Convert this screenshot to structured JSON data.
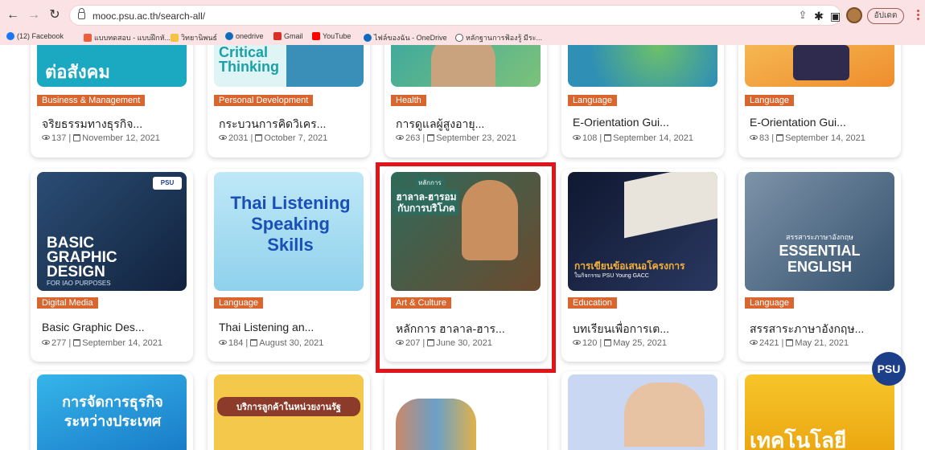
{
  "browser": {
    "url": "mooc.psu.ac.th/search-all/",
    "profile_label": "อัปเดต",
    "bookmarks": [
      {
        "label": "(12) Facebook",
        "color": "#1877f2"
      },
      {
        "label": "แบบทดสอบ - แบบฝึกหั...",
        "color": "#e8613c"
      },
      {
        "label": "วิทยานิพนธ์",
        "color": "#f5c242"
      },
      {
        "label": "onedrive",
        "color": "#0f6cbd"
      },
      {
        "label": "Gmail",
        "color": "#d93025"
      },
      {
        "label": "YouTube",
        "color": "#ff0000"
      },
      {
        "label": "ไฟล์ของฉัน - OneDrive",
        "color": "#0f6cbd"
      },
      {
        "label": "หลักฐานการฟ้องรู้ มีระ...",
        "color": "#555555"
      }
    ]
  },
  "cards_row1": [
    {
      "category": "Business & Management",
      "title": "จริยธรรมทางธุรกิจ...",
      "views": "137",
      "date": "November 12, 2021",
      "thumb_text": "ต่อสังคม",
      "thumb_color": "#1aa9c1"
    },
    {
      "category": "Personal Development",
      "title": "กระบวนการคิดวิเคร...",
      "views": "2031",
      "date": "October 7, 2021",
      "thumb_text": "Critical Thinking",
      "thumb_color": "#dff4f4"
    },
    {
      "category": "Health",
      "title": "การดูแลผู้สูงอายุ...",
      "views": "263",
      "date": "September 23, 2021",
      "thumb_text": "",
      "thumb_color": "#3aa7a0"
    },
    {
      "category": "Language",
      "title": "E-Orientation Gui...",
      "views": "108",
      "date": "September 14, 2021",
      "thumb_text": "",
      "thumb_color": "#2f8fb5"
    },
    {
      "category": "Language",
      "title": "E-Orientation Gui...",
      "views": "83",
      "date": "September 14, 2021",
      "thumb_text": "",
      "thumb_color": "#f2a93b"
    }
  ],
  "cards_row2": [
    {
      "category": "Digital Media",
      "title": "Basic Graphic Des...",
      "views": "277",
      "date": "September 14, 2021",
      "thumb_text": "BASIC GRAPHIC DESIGN",
      "thumb_sub": "FOR IAO PURPOSES",
      "thumb_color": "#1b3355"
    },
    {
      "category": "Language",
      "title": "Thai Listening an...",
      "views": "184",
      "date": "August 30, 2021",
      "thumb_text": "Thai Listening Speaking Skills",
      "thumb_color": "#9fd8ef"
    },
    {
      "category": "Art & Culture",
      "title": "หลักการ ฮาลาล-ฮาร...",
      "views": "207",
      "date": "June 30, 2021",
      "thumb_text": "ฮาลาล-ฮารอม กับการบริโภค",
      "thumb_sub": "หลักการ",
      "thumb_color": "#5a3b26"
    },
    {
      "category": "Education",
      "title": "บทเรียนเพื่อการเต...",
      "views": "120",
      "date": "May 25, 2021",
      "thumb_text": "การเขียนข้อเสนอโครงการ",
      "thumb_sub": "ในกิจกรรม PSU Young GACC",
      "thumb_color": "#141b33"
    },
    {
      "category": "Language",
      "title": "สรรสาระภาษาอังกฤษ...",
      "views": "2421",
      "date": "May 21, 2021",
      "thumb_text": "ESSENTIAL ENGLISH",
      "thumb_sub": "สรรสาระภาษาอังกฤษ",
      "thumb_color": "#4d6a86"
    }
  ],
  "cards_row3": [
    {
      "thumb_text": "การจัดการธุรกิจ ระหว่างประเทศ",
      "thumb_color": "#2aa0e0"
    },
    {
      "thumb_text": "บริการลูกค้าในหน่วยงานรัฐ",
      "thumb_color": "#f3c84b"
    },
    {
      "thumb_text": "",
      "thumb_color": "#ffffff"
    },
    {
      "thumb_text": "",
      "thumb_color": "#c9d7f2"
    },
    {
      "thumb_text": "เทคโนโลยี",
      "thumb_color": "#f3b617"
    }
  ],
  "floating_logo": "PSU"
}
